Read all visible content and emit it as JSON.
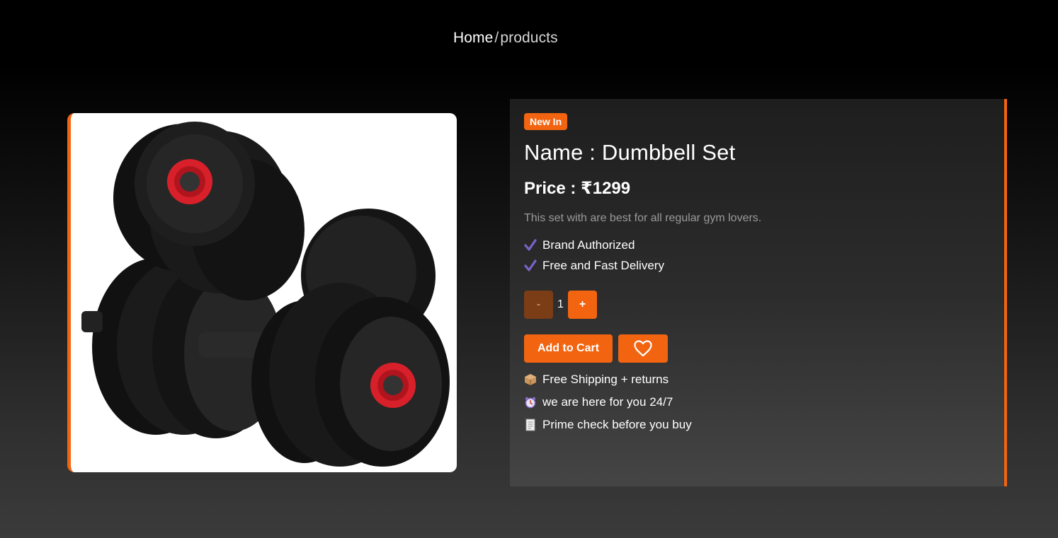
{
  "breadcrumb": {
    "home": "Home",
    "separator": "/",
    "current": "products"
  },
  "product": {
    "badge": "New In",
    "name": "Name : Dumbbell Set",
    "price": "Price : ₹1299",
    "description": "This set with are best for all regular gym lovers.",
    "features": [
      "Brand Authorized",
      "Free and Fast Delivery"
    ],
    "image_icon": "dumbbell-set-photo"
  },
  "quantity": {
    "minus_label": "-",
    "value": "1",
    "plus_label": "+"
  },
  "actions": {
    "add_to_cart": "Add to Cart",
    "wishlist_icon": "heart-icon"
  },
  "perks": [
    {
      "icon": "package-icon",
      "label": "Free Shipping + returns"
    },
    {
      "icon": "alarm-clock-icon",
      "label": "we are here for you 24/7"
    },
    {
      "icon": "receipt-icon",
      "label": "Prime check before you buy"
    }
  ],
  "colors": {
    "accent": "#f26410",
    "check": "#7a64c8",
    "muted_text": "#9a9a9a"
  }
}
